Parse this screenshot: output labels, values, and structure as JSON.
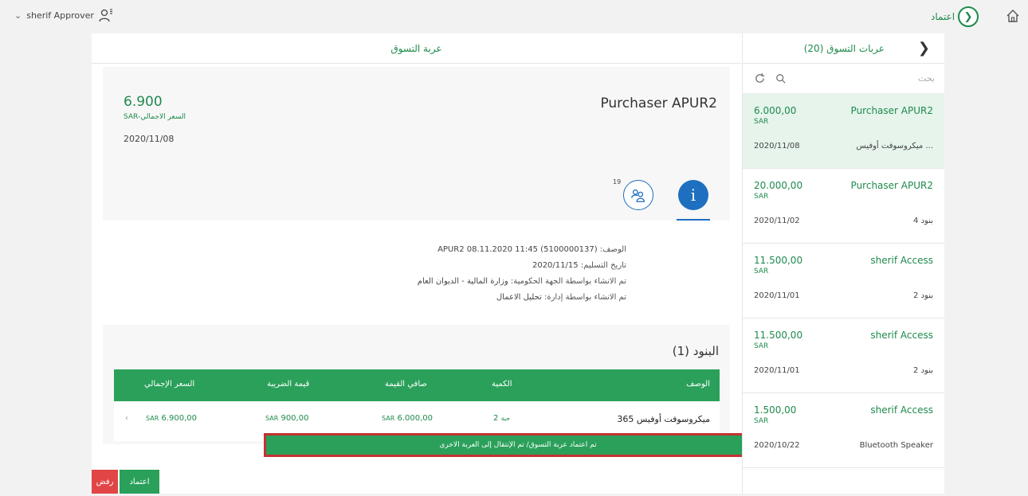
{
  "topbar": {
    "user_label": "sherif Approver",
    "brand_text": "اعتماد",
    "icons": [
      "chevron-down-icon",
      "user-icon",
      "home-icon",
      "brand-logo"
    ]
  },
  "detail": {
    "header_title": "عربة التسوق",
    "amount": "6.900",
    "amount_label": "SAR-السعر الاجمالي",
    "date": "2020/11/08",
    "title": "Purchaser APUR2",
    "approvers_count": "19",
    "info": [
      {
        "key": "الوصف:",
        "value": "APUR2 08.11.2020 11:45 (5100000137)"
      },
      {
        "key": "تاريخ التسليم:",
        "value": "2020/11/15"
      },
      {
        "key": "تم الانشاء بواسطة الجهة الحكومية:",
        "value": "وزارة المالية - الديوان العام"
      },
      {
        "key": "تم الانشاء بواسطة إدارة:",
        "value": "تحليل الاعمال"
      }
    ],
    "items_title": "البنود (1)",
    "table": {
      "headers": [
        "الوصف",
        "الكمية",
        "صافي القيمة",
        "قيمة الضريبة",
        "السعر الإجمالي"
      ],
      "row": {
        "desc": "ميكروسوفت أوفيس 365",
        "qty": "2",
        "qty_unit": "حبة",
        "net_cur": "SAR",
        "net": "6.000,00",
        "tax_cur": "SAR",
        "tax": "900,00",
        "total_cur": "SAR",
        "total": "6.900,00"
      }
    },
    "toast": "تم اعتماد عربة التسوق/ تم الإنتقال إلى العربة الاخرى",
    "approve_label": "اعتماد",
    "reject_label": "رفض"
  },
  "master": {
    "title": "عربات التسوق (20)",
    "search_placeholder": "بحث",
    "items": [
      {
        "title": "Purchaser APUR2",
        "amount": "6.000,00",
        "currency": "SAR",
        "date": "2020/11/08",
        "sub": "ميكروسوفت أوفيس ...",
        "selected": true
      },
      {
        "title": "Purchaser APUR2",
        "amount": "20.000,00",
        "currency": "SAR",
        "date": "2020/11/02",
        "sub": "4 بنود",
        "selected": false
      },
      {
        "title": "sherif Access",
        "amount": "11.500,00",
        "currency": "SAR",
        "date": "2020/11/01",
        "sub": "2 بنود",
        "selected": false
      },
      {
        "title": "sherif Access",
        "amount": "11.500,00",
        "currency": "SAR",
        "date": "2020/11/01",
        "sub": "2 بنود",
        "selected": false
      },
      {
        "title": "sherif Access",
        "amount": "1.500,00",
        "currency": "SAR",
        "date": "2020/10/22",
        "sub": "Bluetooth Speaker",
        "selected": false
      }
    ]
  },
  "colors": {
    "accent": "#1e8a4c",
    "table_header": "#2aa05a",
    "info_blue": "#1e6fbf",
    "reject": "#e14545",
    "toast_border": "#c43232"
  }
}
